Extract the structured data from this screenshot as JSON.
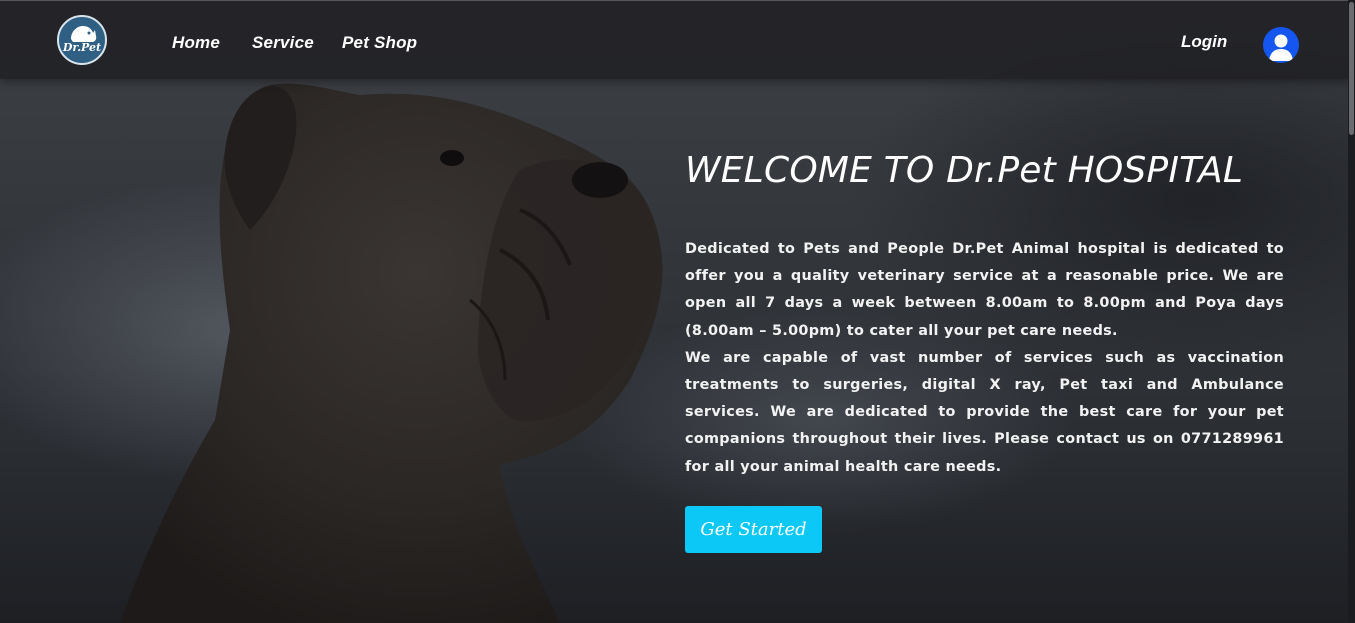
{
  "brand": {
    "logo_text": "Dr.Pet"
  },
  "nav": {
    "links": [
      {
        "label": "Home"
      },
      {
        "label": "Service"
      },
      {
        "label": "Pet Shop"
      }
    ],
    "login_label": "Login"
  },
  "hero": {
    "title": "WELCOME TO Dr.Pet HOSPITAL",
    "paragraph_1": "Dedicated to Pets and People Dr.Pet Animal hospital is dedicated to offer you a quality veterinary service at a reasonable price. We are open all 7 days a week between 8.00am to 8.00pm and Poya days (8.00am – 5.00pm) to cater all your pet care needs.",
    "paragraph_2": "We are capable of vast number of services such as vaccination treatments to surgeries, digital X ray, Pet taxi and Ambulance services. We are dedicated to provide the best care for your pet companions throughout their lives. Please contact us on 0771289961 for all your animal health care needs.",
    "cta_label": "Get Started"
  },
  "colors": {
    "cta": "#0bc8f7",
    "avatar": "#1656f0",
    "logo_bg": "#2f5f82"
  },
  "icons": {
    "logo": "dog-cat-silhouette-icon",
    "avatar": "user-avatar-icon"
  }
}
